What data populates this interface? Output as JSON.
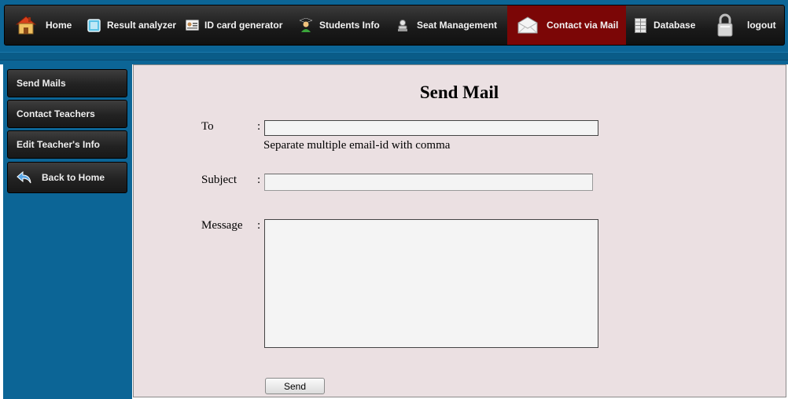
{
  "nav": {
    "items": [
      {
        "label": "Home",
        "icon": "home-icon"
      },
      {
        "label": "Result analyzer",
        "icon": "result-analyzer-icon"
      },
      {
        "label": "ID card generator",
        "icon": "id-card-icon"
      },
      {
        "label": "Students Info",
        "icon": "student-icon"
      },
      {
        "label": "Seat Management",
        "icon": "seat-icon"
      },
      {
        "label": "Contact via Mail",
        "icon": "mail-icon",
        "active": true
      },
      {
        "label": "Database",
        "icon": "database-icon"
      },
      {
        "label": "logout",
        "icon": "lock-icon"
      }
    ]
  },
  "sidebar": {
    "items": [
      {
        "label": "Send Mails"
      },
      {
        "label": "Contact Teachers"
      },
      {
        "label": "Edit Teacher's Info"
      },
      {
        "label": "Back to Home",
        "icon": "back-arrow-icon"
      }
    ]
  },
  "form": {
    "title": "Send Mail",
    "to_label": "To",
    "subject_label": "Subject",
    "message_label": "Message",
    "colon": ":",
    "to_value": "",
    "subject_value": "",
    "message_value": "",
    "hint": "Separate multiple email-id with comma",
    "send_label": "Send"
  },
  "colors": {
    "accent_blue": "#0c6596",
    "nav_active": "#7b0606",
    "content_bg": "#ebe0e2"
  }
}
